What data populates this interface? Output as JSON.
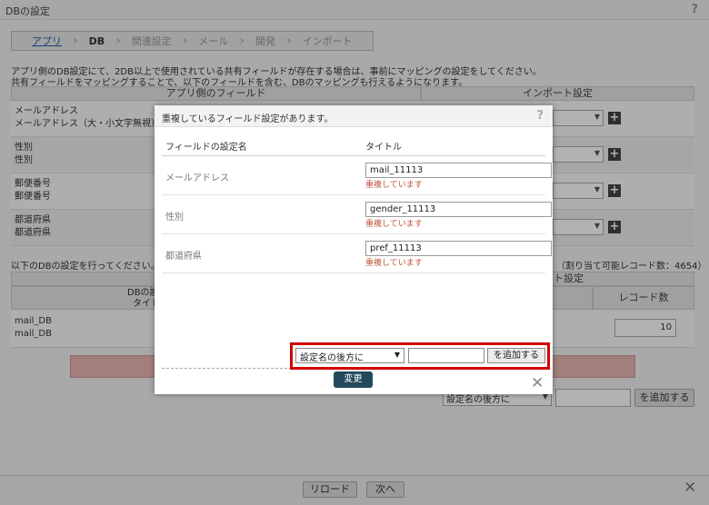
{
  "window": {
    "title": "DBの設定",
    "help": "?"
  },
  "breadcrumb": [
    {
      "label": "アプリ",
      "state": "link"
    },
    {
      "label": "DB",
      "state": "current"
    },
    {
      "label": "関連設定",
      "state": "inactive"
    },
    {
      "label": "メール",
      "state": "inactive"
    },
    {
      "label": "開発",
      "state": "inactive"
    },
    {
      "label": "インポート",
      "state": "inactive"
    }
  ],
  "intro": {
    "line1": "アプリ側のDB設定にて、2DB以上で使用されている共有フィールドが存在する場合は、事前にマッピングの設定をしてください。",
    "line2": "共有フィールドをマッピングすることで、以下のフィールドを含む、DBのマッピングも行えるようになります。"
  },
  "mapping_table": {
    "col_app": "アプリ側のフィールド",
    "col_import": "インポート設定",
    "rows": [
      {
        "line1": "メールアドレス",
        "line2": "メールアドレス（大・小文字無視）"
      },
      {
        "line1": "性別",
        "line2": "性別"
      },
      {
        "line1": "郵便番号",
        "line2": "郵便番号"
      },
      {
        "line1": "都道府県",
        "line2": "都道府県"
      }
    ]
  },
  "db_section": {
    "instruction": "以下のDBの設定を行ってください。",
    "quota": "（割り当て可能レコード数：4654）",
    "col_db_setting_a": "DBの設",
    "col_db_setting_b": "タイト",
    "col_import_setting": "ト設定",
    "col_record_count": "レコード数",
    "db_name_1": "mail_DB",
    "db_name_2": "mail_DB",
    "record_value": "10",
    "position_select": "設定名の後方に",
    "add_button": "を追加する"
  },
  "footer": {
    "reload": "リロード",
    "next": "次へ",
    "close": "✕"
  },
  "modal": {
    "title": "重複しているフィールド設定があります。",
    "help": "?",
    "header_name": "フィールドの設定名",
    "header_title": "タイトル",
    "rows": [
      {
        "name": "メールアドレス",
        "value": "mail_11113",
        "error": "重複しています"
      },
      {
        "name": "性別",
        "value": "gender_11113",
        "error": "重複しています"
      },
      {
        "name": "都道府県",
        "value": "pref_11113",
        "error": "重複しています"
      }
    ],
    "position_select": "設定名の後方に",
    "add_button": "を追加する",
    "change_button": "変更",
    "close": "✕"
  }
}
